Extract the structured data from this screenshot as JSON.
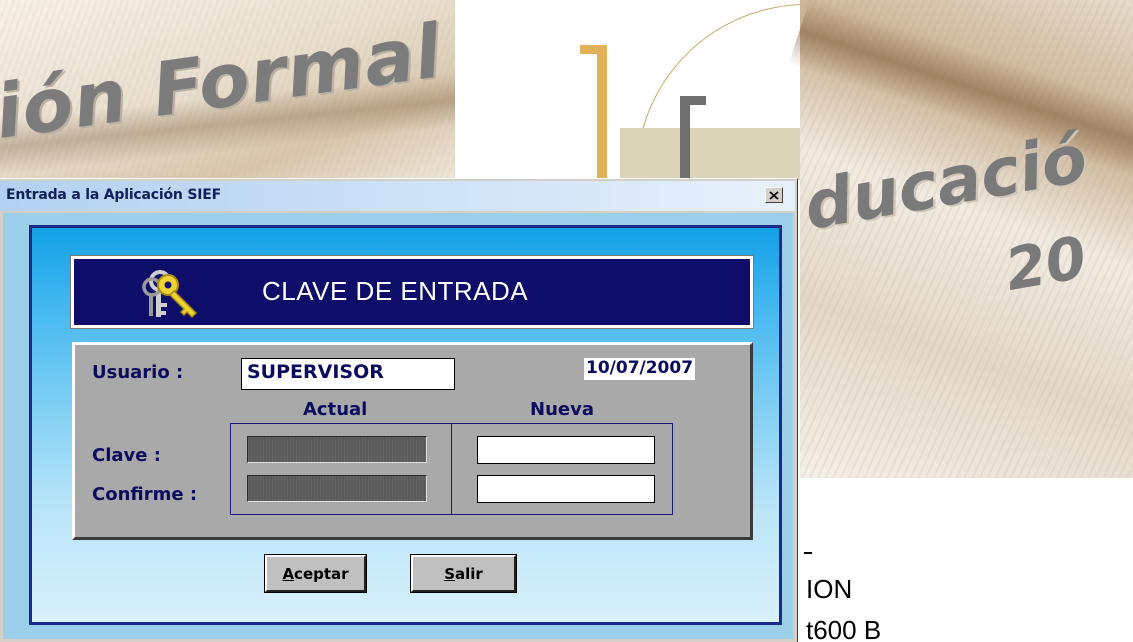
{
  "background": {
    "left_word": "ión Formal",
    "right_word": "ducació",
    "right_year": "20",
    "right_line1": "ION",
    "right_line2": "t600 B"
  },
  "dialog": {
    "title": "Entrada a la Aplicación SIEF",
    "close_glyph": "✕",
    "header_title": "CLAVE DE ENTRADA",
    "user_label": "Usuario :",
    "user_value": "SUPERVISOR",
    "date": "10/07/2007",
    "col_actual": "Actual",
    "col_nueva": "Nueva",
    "clave_label": "Clave :",
    "confirme_label": "Confirme :",
    "accept_button": {
      "access_key": "A",
      "rest": "ceptar"
    },
    "exit_button": {
      "access_key": "S",
      "rest": "alir"
    }
  },
  "colors": {
    "title_gradient_start": "#b2d1f2",
    "banner_bg": "#0e0e6a",
    "panel_bg": "#a9a9a9",
    "label_text": "#0a0a5e",
    "client_gradient_top": "#12a0e6",
    "client_gradient_bottom": "#d9f1fb"
  },
  "icons": {
    "header": "keys-icon",
    "close": "close-icon"
  }
}
